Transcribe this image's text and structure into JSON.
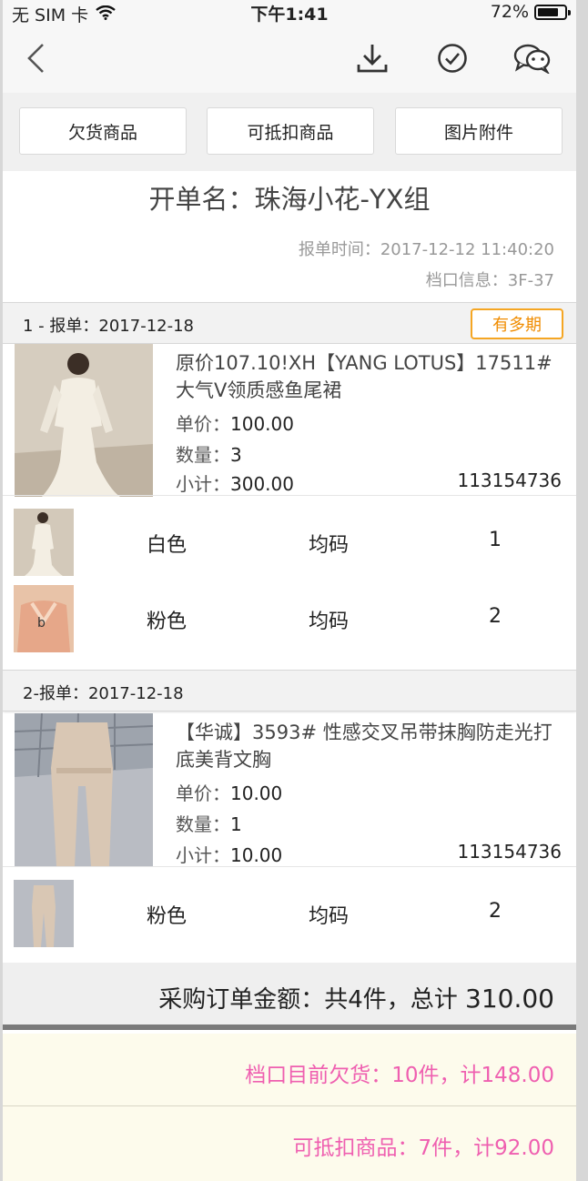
{
  "status_bar": {
    "carrier": "无 SIM 卡",
    "time": "下午1:41",
    "battery": "72%"
  },
  "nav": {
    "icons": [
      "back-icon",
      "download-icon",
      "check-circle-icon",
      "wechat-icon"
    ]
  },
  "tabs": [
    "欠货商品",
    "可抵扣商品",
    "图片附件"
  ],
  "header": {
    "title": "开单名：珠海小花-YX组",
    "report_time_label": "报单时间：",
    "report_time": "2017-12-12 11:40:20",
    "stall_label": "档口信息：",
    "stall": "3F-37"
  },
  "orders": [
    {
      "header": "1 - 报单：2017-12-18",
      "badge": "有多期",
      "product": {
        "name": "原价107.10!XH【YANG LOTUS】17511# 大气V领质感鱼尾裙",
        "price_label": "单价：",
        "price": "100.00",
        "qty_label": "数量：",
        "qty": "3",
        "subtotal_label": "小计：",
        "subtotal": "300.00",
        "code": "113154736"
      },
      "variants": [
        {
          "color": "白色",
          "size": "均码",
          "qty": "1"
        },
        {
          "color": "粉色",
          "size": "均码",
          "qty": "2"
        }
      ]
    },
    {
      "header": "2-报单：2017-12-18",
      "product": {
        "name": "【华诚】3593# 性感交叉吊带抹胸防走光打底美背文胸",
        "price_label": "单价：",
        "price": "10.00",
        "qty_label": "数量：",
        "qty": "1",
        "subtotal_label": "小计：",
        "subtotal": "10.00",
        "code": "113154736"
      },
      "variants": [
        {
          "color": "粉色",
          "size": "均码",
          "qty": "2"
        }
      ]
    }
  ],
  "summary": {
    "label": "采购订单金额：共4件，总计",
    "amount": "310.00"
  },
  "stall_owe": "档口目前欠货：10件，计148.00",
  "deductible": "可抵扣商品：7件，计92.00",
  "colors": {
    "accent_orange": "#f08c00",
    "pink_text": "#ef5fb0",
    "cream_bg": "#fdfbec"
  }
}
